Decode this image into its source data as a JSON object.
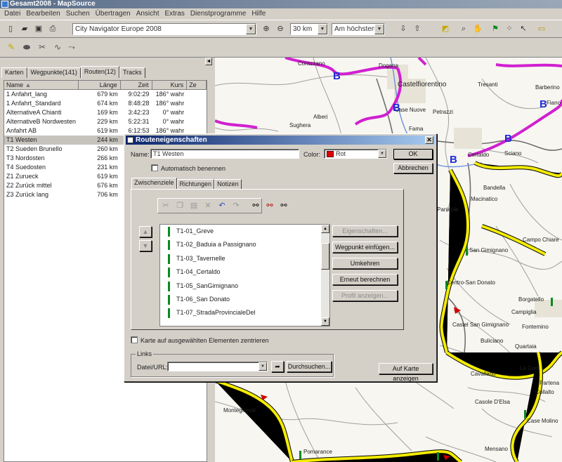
{
  "app": {
    "title": "Gesamt2008 - MapSource"
  },
  "menu": [
    "Datei",
    "Bearbeiten",
    "Suchen",
    "Übertragen",
    "Ansicht",
    "Extras",
    "Dienstprogramme",
    "Hilfe"
  ],
  "toolbar": {
    "map_product": "City Navigator Europe 2008",
    "zoom": "30 km",
    "detail": "Am höchsten"
  },
  "side_panel": {
    "tabs": [
      "Karten",
      "Wegpunkte(141)",
      "Routen(12)",
      "Tracks"
    ],
    "active_tab": "Routen(12)",
    "columns": [
      "Name",
      "Länge",
      "Zeit",
      "Kurs",
      "Ze"
    ],
    "routes": [
      {
        "name": "1 Anfahrt_lang",
        "length": "679 km",
        "time": "9:02:29",
        "course": "186° wahr"
      },
      {
        "name": "1 Anfahrt_Standard",
        "length": "674 km",
        "time": "8:48:28",
        "course": "186° wahr"
      },
      {
        "name": "AlternativeA Chianti",
        "length": "169 km",
        "time": "3:42:23",
        "course": "0° wahr"
      },
      {
        "name": "AlternativeB Nordwesten",
        "length": "229 km",
        "time": "5:22:31",
        "course": "0° wahr"
      },
      {
        "name": "Anfahrt AB",
        "length": "619 km",
        "time": "6:12:53",
        "course": "186° wahr"
      },
      {
        "name": "T1 Westen",
        "length": "244 km",
        "time": "",
        "course": ""
      },
      {
        "name": "T2 Sueden Brunello",
        "length": "260 km",
        "time": "",
        "course": ""
      },
      {
        "name": "T3 Nordosten",
        "length": "266 km",
        "time": "",
        "course": ""
      },
      {
        "name": "T4 Suedosten",
        "length": "231 km",
        "time": "",
        "course": ""
      },
      {
        "name": "Z1 Zurueck",
        "length": "619 km",
        "time": "",
        "course": ""
      },
      {
        "name": "Z2 Zurück mittel",
        "length": "676 km",
        "time": "",
        "course": ""
      },
      {
        "name": "Z3 Zurück lang",
        "length": "706 km",
        "time": "",
        "course": ""
      }
    ],
    "selected": "T1 Westen"
  },
  "dialog": {
    "title": "Routeneigenschaften",
    "name_label": "Name:",
    "name_value": "T1 Westen",
    "color_label": "Color:",
    "color_value": "Rot",
    "color_swatch": "#e00000",
    "auto_name_label": "Automatisch benennen",
    "ok_label": "OK",
    "cancel_label": "Abbrechen",
    "tabs": [
      "Zwischenziele",
      "Richtungen",
      "Notizen"
    ],
    "waypoints": [
      "T1-01_Greve",
      "T1-02_Baduia a Passignano",
      "T1-03_Tavernelle",
      "T1-04_Certaldo",
      "T1-05_SanGimignano",
      "T1-06_San Donato",
      "T1-07_StradaProvincialeDel"
    ],
    "actions": {
      "properties": "Eigenschaften...",
      "insert": "Wegpunkt einfügen...",
      "reverse": "Umkehren",
      "recalc": "Erneut berechnen",
      "profile": "Profil anzeigen..."
    },
    "center_label": "Karte auf ausgewählten Elementen zentrieren",
    "links_label": "Links",
    "file_url_label": "Datei/URL:",
    "browse_label": "Durchsuchen...",
    "show_map_label": "Auf Karte anzeigen"
  },
  "map": {
    "places": [
      "Corazzano",
      "Dogana",
      "Castelfiorentino",
      "Tresanti",
      "Barberino",
      "Fiano",
      "Alberi",
      "Case Nuove",
      "Petrazzi",
      "Sughera",
      "Fama",
      "Certaldo",
      "Sciano",
      "Bandella",
      "Macinatico",
      "Panicole",
      "San Gimignano",
      "Campo Chiare",
      "Centro-San Donato",
      "Borgatello",
      "Campiglia",
      "Castel San Gimignano",
      "Fontemino",
      "Buliciano",
      "Quartaia",
      "Le Corti",
      "Cavallano",
      "Partena",
      "Collalto",
      "Montegemoli",
      "Casole D'Elsa",
      "Case Molino",
      "Pomarance",
      "Mensano"
    ],
    "route_color": "#f4ec00",
    "alt_route_color": "#d020d0"
  }
}
